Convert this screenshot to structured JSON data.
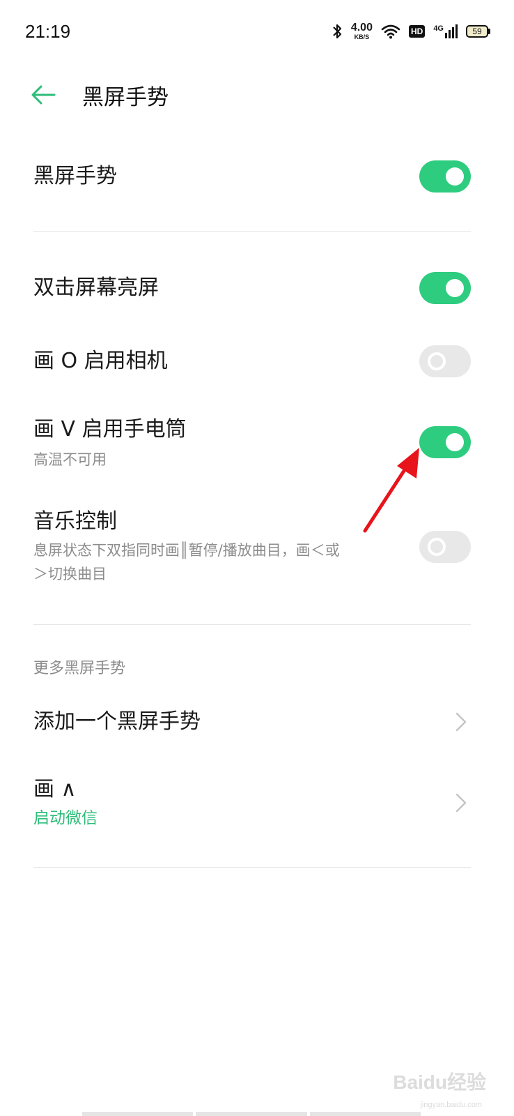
{
  "status_bar": {
    "time": "21:19",
    "net_speed_value": "4.00",
    "net_speed_unit": "KB/S",
    "hd_label": "HD",
    "network_type": "4G",
    "battery_level": "59"
  },
  "header": {
    "title": "黑屏手势"
  },
  "settings": {
    "master": {
      "label": "黑屏手势",
      "enabled": true
    },
    "double_tap": {
      "label": "双击屏幕亮屏",
      "enabled": true
    },
    "draw_o": {
      "label": "画 O 启用相机",
      "enabled": false
    },
    "draw_v": {
      "label": "画 V 启用手电筒",
      "sub": "高温不可用",
      "enabled": true
    },
    "music": {
      "label": "音乐控制",
      "sub_line1": "息屏状态下双指同时画║暂停/播放曲目，画＜或",
      "sub_line2": "＞切换曲目",
      "enabled": false
    }
  },
  "more_section": {
    "header": "更多黑屏手势",
    "add_label": "添加一个黑屏手势",
    "custom_label": "画 ∧",
    "custom_sub": "启动微信"
  },
  "watermark": {
    "main": "Baidu经验",
    "sub": "jingyan.baidu.com"
  },
  "colors": {
    "accent_green": "#2ecc7f",
    "toggle_off": "#e8e8e8",
    "annotation_red": "#e8141b"
  }
}
